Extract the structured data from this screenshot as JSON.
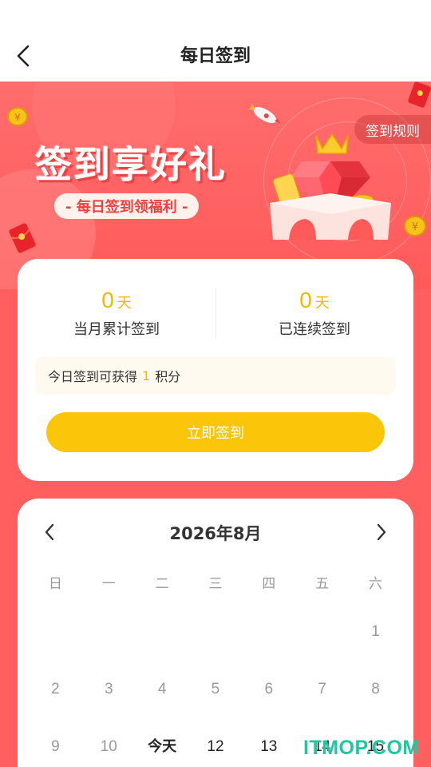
{
  "header": {
    "title": "每日签到"
  },
  "banner": {
    "headline": "签到享好礼",
    "pill": "- 每日签到领福利 -",
    "rules_button": "签到规则"
  },
  "stats": {
    "monthly_value": "0",
    "monthly_unit": "天",
    "monthly_label": "当月累计签到",
    "streak_value": "0",
    "streak_unit": "天",
    "streak_label": "已连续签到"
  },
  "points": {
    "prefix": "今日签到可获得",
    "value": "1",
    "suffix": "积分"
  },
  "sign_button": "立即签到",
  "calendar": {
    "month_label": "2026年8月",
    "weekdays": [
      "日",
      "一",
      "二",
      "三",
      "四",
      "五",
      "六"
    ],
    "rows": [
      [
        "",
        "",
        "",
        "",
        "",
        "",
        "1"
      ],
      [
        "2",
        "3",
        "4",
        "5",
        "6",
        "7",
        "8"
      ],
      [
        "9",
        "10",
        "今天",
        "12",
        "13",
        "14",
        "15"
      ]
    ]
  },
  "watermark": "ITMOP.COM",
  "colors": {
    "accent": "#fbc60a",
    "background": "#ff5f5f",
    "number": "#f5b700"
  }
}
